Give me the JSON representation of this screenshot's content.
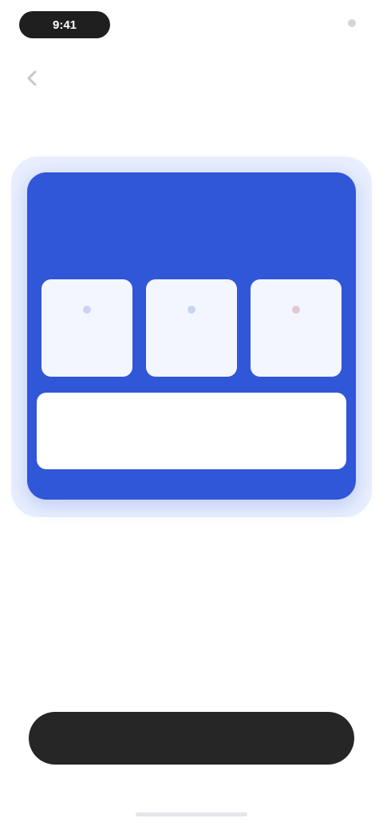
{
  "status_bar": {
    "time": "9:41",
    "carrier": "",
    "right": ""
  },
  "header": {
    "title": "",
    "back_icon": "chevron-left-icon"
  },
  "card": {
    "title": "",
    "subtitle": "",
    "stats": [
      {
        "icon": "dot-icon",
        "value": "",
        "label": ""
      },
      {
        "icon": "dot-icon",
        "value": "",
        "label": ""
      },
      {
        "icon": "dot-icon",
        "value": "",
        "label": ""
      }
    ],
    "total_label": "",
    "total_value": ""
  },
  "description": "",
  "note": "",
  "primary_button": {
    "label": ""
  },
  "colors": {
    "accent": "#2f57d7",
    "button": "#262626"
  }
}
